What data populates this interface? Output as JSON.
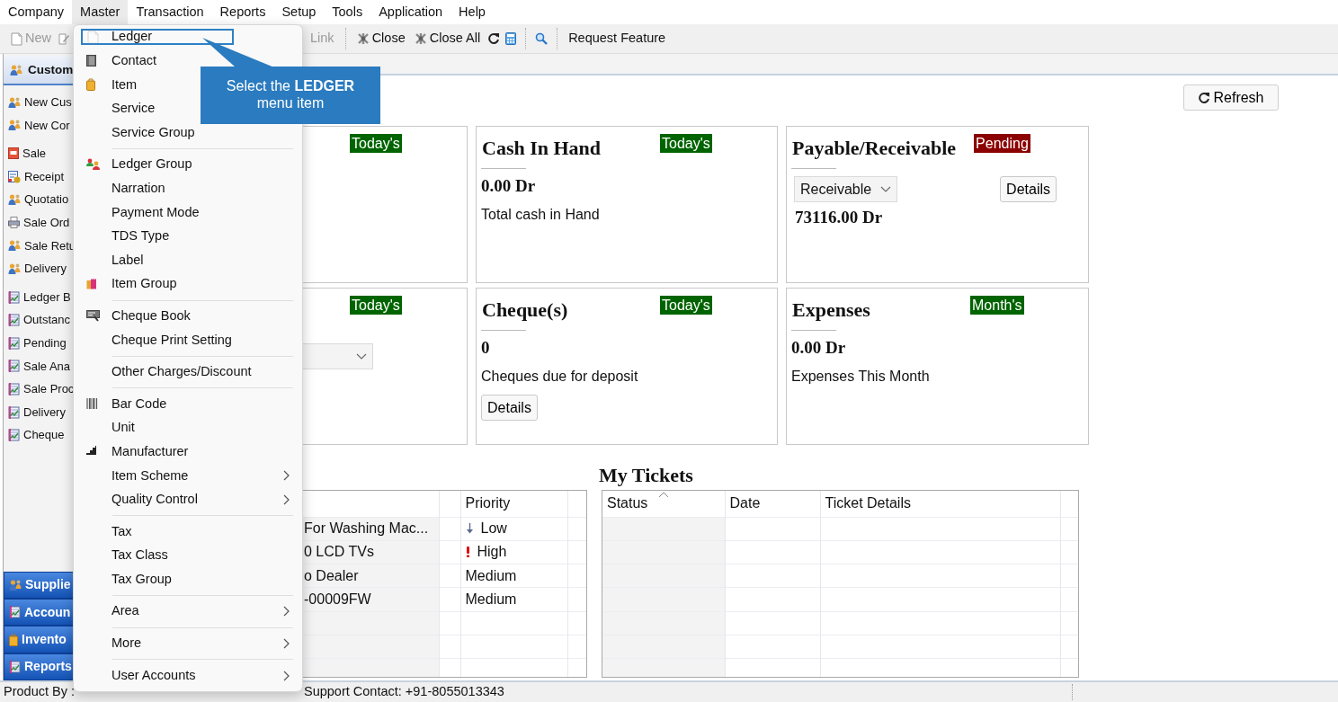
{
  "menubar": [
    {
      "label": "Company",
      "selected": false
    },
    {
      "label": "Master",
      "selected": true
    },
    {
      "label": "Transaction",
      "selected": false
    },
    {
      "label": "Reports",
      "selected": false
    },
    {
      "label": "Setup",
      "selected": false
    },
    {
      "label": "Tools",
      "selected": false
    },
    {
      "label": "Application",
      "selected": false
    },
    {
      "label": "Help",
      "selected": false
    }
  ],
  "toolbar": [
    {
      "label": "New",
      "disabled": true
    },
    {
      "label": "Link",
      "disabled": true
    },
    {
      "label": "Close",
      "disabled": false
    },
    {
      "label": "Close All",
      "disabled": false
    },
    {
      "label": "Request Feature",
      "disabled": false
    }
  ],
  "sidebar": {
    "header": "Custom",
    "groups": [
      [
        "New Cus",
        "New Cor"
      ],
      [
        "Sale",
        "Receipt",
        "Quotatio",
        "Sale Ord",
        "Sale Retu",
        "Delivery"
      ],
      [
        "Ledger B",
        "Outstanc",
        "Pending",
        "Sale Ana",
        "Sale Proc",
        "Delivery",
        "Cheque"
      ]
    ],
    "sections": [
      "Supplie",
      "Accoun",
      "Invento",
      "Reports"
    ]
  },
  "refresh_button": "Refresh",
  "cards": [
    {
      "badge": {
        "text": "Today's",
        "color": "#006400"
      }
    },
    {
      "title": "Cash In Hand",
      "badge": {
        "text": "Today's",
        "color": "#006400"
      },
      "value": "0.00 Dr",
      "caption": "Total cash in Hand"
    },
    {
      "title": "Payable/Receivable",
      "badge": {
        "text": "Pending",
        "color": "#8b0000"
      },
      "dropdown": {
        "value": "Receivable"
      },
      "details_button": "Details",
      "value": "73116.00 Dr"
    },
    {
      "badge": {
        "text": "Today's",
        "color": "#006400"
      },
      "blank_dropdown": true
    },
    {
      "title": "Cheque(s)",
      "badge": {
        "text": "Today's",
        "color": "#006400"
      },
      "value": "0",
      "caption": "Cheques due for deposit",
      "details_button": "Details"
    },
    {
      "title": "Expenses",
      "badge": {
        "text": "Month's",
        "color": "#006400"
      },
      "value": "0.00 Dr",
      "caption": "Expenses This Month"
    }
  ],
  "tasks_table": {
    "columns": [
      "Priority"
    ],
    "rows": [
      {
        "column_1": "For Washing Mac...",
        "priority": "Low",
        "kind": "low"
      },
      {
        "column_1": "0 LCD TVs",
        "priority": "High",
        "kind": "high"
      },
      {
        "column_1": "o Dealer",
        "priority": "Medium",
        "kind": "plain"
      },
      {
        "column_1": "-00009FW",
        "priority": "Medium",
        "kind": "plain"
      }
    ]
  },
  "tickets": {
    "title": "My Tickets",
    "columns": [
      {
        "label": "Status",
        "sorted": true
      },
      {
        "label": "Date",
        "sorted": false
      },
      {
        "label": "Ticket Details",
        "sorted": false
      }
    ]
  },
  "master_menu": {
    "groups": [
      [
        {
          "label": "Ledger",
          "selected": true,
          "submenu": false
        },
        {
          "label": "Contact",
          "selected": false,
          "submenu": false
        },
        {
          "label": "Item",
          "selected": false,
          "submenu": false
        },
        {
          "label": "Service",
          "selected": false,
          "submenu": false
        },
        {
          "label": "Service Group",
          "selected": false,
          "submenu": false
        }
      ],
      [
        {
          "label": "Ledger Group",
          "selected": false,
          "submenu": false
        },
        {
          "label": "Narration",
          "selected": false,
          "submenu": false
        },
        {
          "label": "Payment Mode",
          "selected": false,
          "submenu": false
        },
        {
          "label": "TDS Type",
          "selected": false,
          "submenu": false
        },
        {
          "label": "Label",
          "selected": false,
          "submenu": false
        },
        {
          "label": "Item Group",
          "selected": false,
          "submenu": false
        }
      ],
      [
        {
          "label": "Cheque Book",
          "selected": false,
          "submenu": false
        },
        {
          "label": "Cheque Print Setting",
          "selected": false,
          "submenu": false
        }
      ],
      [
        {
          "label": "Other Charges/Discount",
          "selected": false,
          "submenu": false
        }
      ],
      [
        {
          "label": "Bar Code",
          "selected": false,
          "submenu": false
        },
        {
          "label": "Unit",
          "selected": false,
          "submenu": false
        },
        {
          "label": "Manufacturer",
          "selected": false,
          "submenu": false
        },
        {
          "label": "Item Scheme",
          "selected": false,
          "submenu": true
        },
        {
          "label": "Quality Control",
          "selected": false,
          "submenu": true
        }
      ],
      [
        {
          "label": "Tax",
          "selected": false,
          "submenu": false
        },
        {
          "label": "Tax Class",
          "selected": false,
          "submenu": false
        },
        {
          "label": "Tax Group",
          "selected": false,
          "submenu": false
        }
      ],
      [
        {
          "label": "Area",
          "selected": false,
          "submenu": true
        }
      ],
      [
        {
          "label": "More",
          "selected": false,
          "submenu": true
        }
      ],
      [
        {
          "label": "User Accounts",
          "selected": false,
          "submenu": true
        }
      ]
    ]
  },
  "callout": {
    "text": "Select the **LEDGER** menu item"
  },
  "status_bar": [
    "Product By :",
    "Support Contact: +91-8055013343"
  ]
}
